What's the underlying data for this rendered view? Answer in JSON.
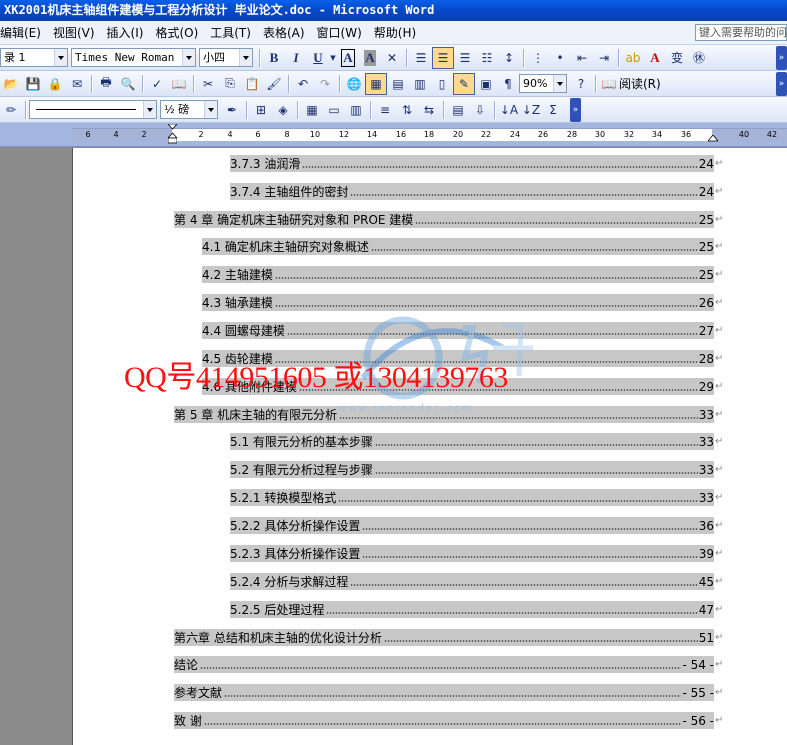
{
  "window": {
    "title": "XK2001机床主轴组件建模与工程分析设计 毕业论文.doc - Microsoft Word"
  },
  "menu": {
    "items": [
      "编辑(E)",
      "视图(V)",
      "插入(I)",
      "格式(O)",
      "工具(T)",
      "表格(A)",
      "窗口(W)",
      "帮助(H)"
    ],
    "help_placeholder": "键入需要帮助的问"
  },
  "toolbar": {
    "style_value": "录 1",
    "font_value": "Times New Roman",
    "size_value": "小四",
    "zoom_value": "90%",
    "read_label": "阅读(R)",
    "border_weight": "½ 磅"
  },
  "ruler": {
    "ticks": [
      "6",
      "4",
      "2",
      "2",
      "4",
      "6",
      "8",
      "10",
      "12",
      "14",
      "16",
      "18",
      "20",
      "22",
      "24",
      "26",
      "28",
      "30",
      "32",
      "34",
      "36",
      "40",
      "42"
    ]
  },
  "toc": [
    {
      "label": "3.7.3  油润滑",
      "page": "24"
    },
    {
      "label": "3.7.4  主轴组件的密封",
      "page": "24"
    },
    {
      "label": "第 4 章  确定机床主轴研究对象和 PROE 建模",
      "page": "25"
    },
    {
      "label": "4.1 确定机床主轴研究对象概述",
      "page": "25"
    },
    {
      "label": "4.2  主轴建模",
      "page": "25"
    },
    {
      "label": "4.3  轴承建模",
      "page": "26"
    },
    {
      "label": "4.4  圆螺母建模",
      "page": "27"
    },
    {
      "label": "4.5  齿轮建模",
      "page": "28"
    },
    {
      "label": "4.6  其他附件建模",
      "page": "29"
    },
    {
      "label": "第 5 章  机床主轴的有限元分析",
      "page": "33"
    },
    {
      "label": "5.1 有限元分析的基本步骤",
      "page": "33"
    },
    {
      "label": "5.2  有限元分析过程与步骤",
      "page": "33"
    },
    {
      "label": "5.2.1  转换模型格式",
      "page": "33"
    },
    {
      "label": "5.2.2  具体分析操作设置",
      "page": "36"
    },
    {
      "label": "5.2.3  具体分析操作设置",
      "page": "39"
    },
    {
      "label": "5.2.4 分析与求解过程",
      "page": "45"
    },
    {
      "label": "5.2.5 后处理过程",
      "page": "47"
    },
    {
      "label": "第六章  总结和机床主轴的优化设计分析",
      "page": "51"
    },
    {
      "label": "结论",
      "page": "- 54 -"
    },
    {
      "label": "参考文献",
      "page": "- 55 -"
    },
    {
      "label": "致    谢",
      "page": "- 56 -"
    }
  ],
  "overlay": {
    "contact": "QQ号414951605  或1304139763",
    "watermark_url": "www.renrendoc.com"
  },
  "colors": {
    "title_bar": "#0a5fe8",
    "toc_highlight": "#c7c7c7",
    "overlay_text": "#ff1010"
  }
}
